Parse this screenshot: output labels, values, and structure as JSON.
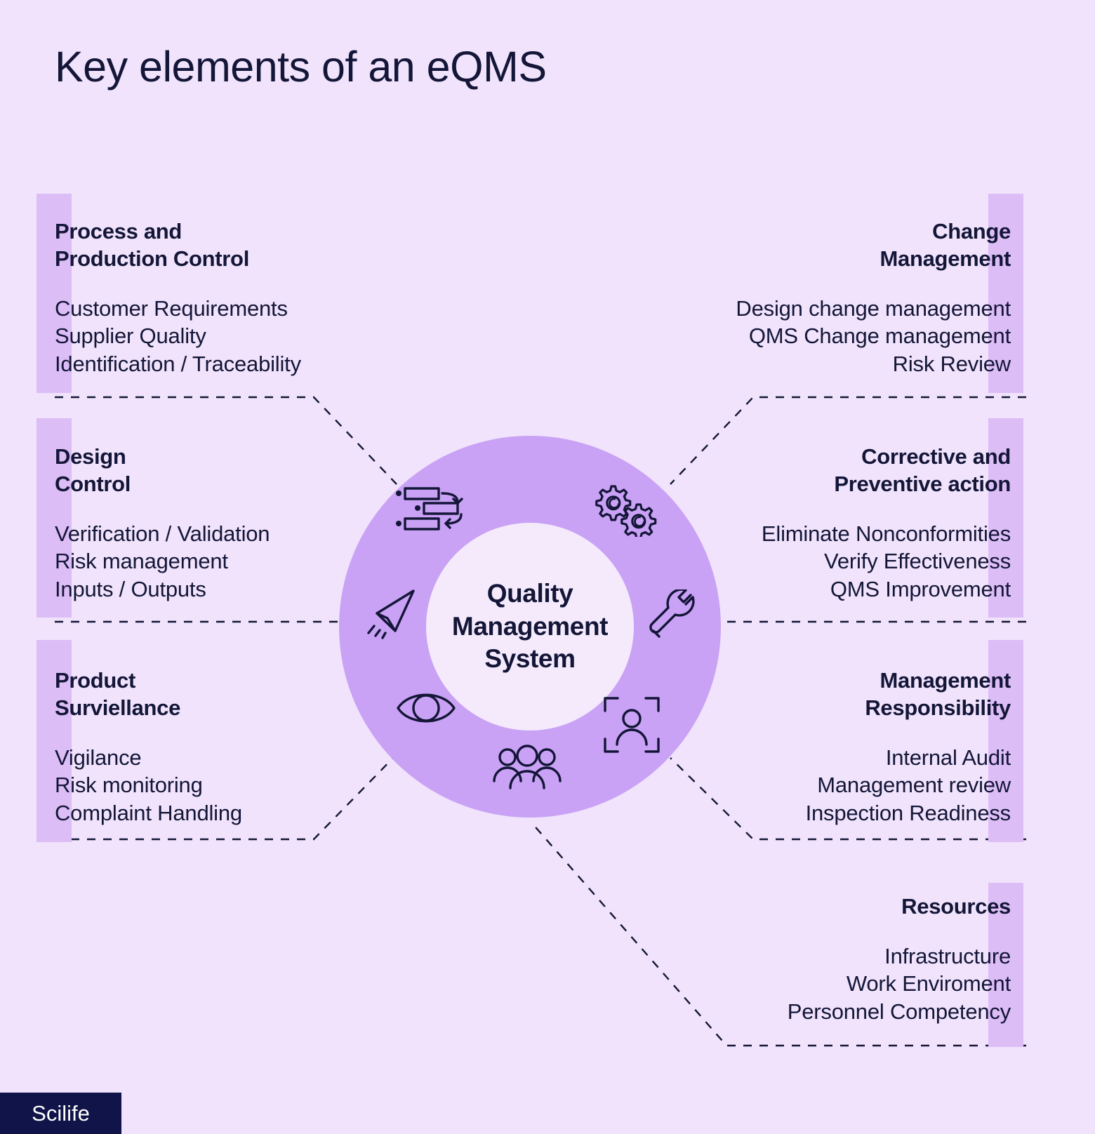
{
  "page": {
    "title": "Key elements of an eQMS",
    "background_color": "#f0e3fb",
    "accent_color": "#dcbdf6",
    "ring_color": "#c9a2f5",
    "text_color": "#141638"
  },
  "center": {
    "label": "Quality\nManagement\nSystem",
    "icons": [
      {
        "name": "process-flow-icon",
        "position": "top-left"
      },
      {
        "name": "gears-icon",
        "position": "top-right"
      },
      {
        "name": "wrench-icon",
        "position": "right"
      },
      {
        "name": "person-scan-icon",
        "position": "bottom-right"
      },
      {
        "name": "people-group-icon",
        "position": "bottom"
      },
      {
        "name": "eye-icon",
        "position": "bottom-left"
      },
      {
        "name": "paper-plane-icon",
        "position": "left"
      }
    ]
  },
  "left_blocks": [
    {
      "title": "Process and\nProduction Control",
      "items": [
        "Customer Requirements",
        "Supplier Quality",
        "Identification / Traceability"
      ]
    },
    {
      "title": "Design\nControl",
      "items": [
        "Verification / Validation",
        "Risk management",
        "Inputs / Outputs"
      ]
    },
    {
      "title": "Product\nSurviellance",
      "items": [
        "Vigilance",
        "Risk monitoring",
        "Complaint Handling"
      ]
    }
  ],
  "right_blocks": [
    {
      "title": "Change\nManagement",
      "items": [
        "Design change management",
        "QMS Change management",
        "Risk Review"
      ]
    },
    {
      "title": "Corrective and\nPreventive action",
      "items": [
        "Eliminate Nonconformities",
        "Verify Effectiveness",
        "QMS Improvement"
      ]
    },
    {
      "title": "Management\nResponsibility",
      "items": [
        "Internal Audit",
        "Management review",
        "Inspection Readiness"
      ]
    },
    {
      "title": "Resources",
      "items": [
        "Infrastructure",
        "Work Enviroment",
        "Personnel Competency"
      ]
    }
  ],
  "footer": {
    "logo_text": "Scilife"
  }
}
